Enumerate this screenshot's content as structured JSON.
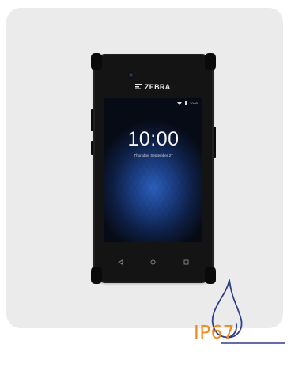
{
  "device": {
    "brand": "ZEBRA",
    "status_time": "10:00",
    "clock": "10:00",
    "date": "Thursday, September 27"
  },
  "badge": {
    "label": "IP67",
    "label_color": "#f08a1c",
    "drop_color": "#2e3f8c"
  },
  "colors": {
    "card_background": "#ebebeb",
    "phone_body": "#141414"
  },
  "icons": {
    "back": "back-triangle-icon",
    "home": "home-circle-icon",
    "recents": "recents-square-icon"
  }
}
